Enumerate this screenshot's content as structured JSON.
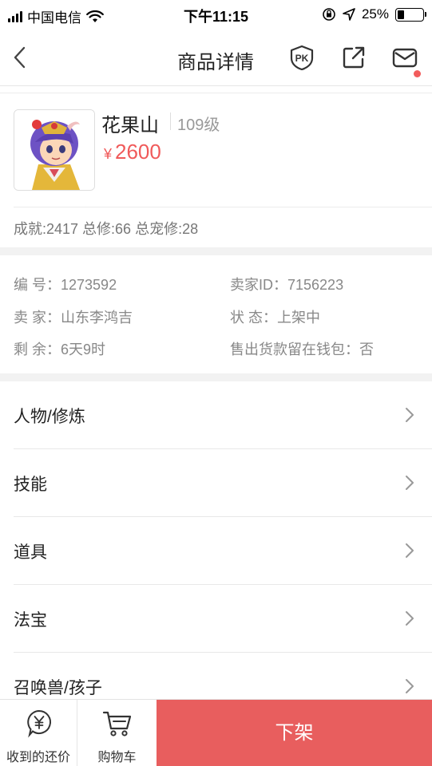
{
  "status_bar": {
    "carrier": "中国电信",
    "time": "下午11:15",
    "battery": "25%",
    "battery_level": 0.25
  },
  "nav": {
    "title": "商品详情",
    "icons": [
      "back-chevron-icon",
      "pk-badge-icon",
      "share-icon",
      "mail-icon"
    ],
    "has_unread_mail": true
  },
  "product": {
    "name": "花果山",
    "level": "109级",
    "currency_symbol": "¥",
    "price": "2600",
    "stats": "成就:2417 总修:66 总宠修:28"
  },
  "info": {
    "serial_number": "编 号：1273592",
    "seller_id": "卖家ID：7156223",
    "seller": "卖 家：山东李鸿吉",
    "status": "状 态：上架中",
    "remaining": "剩 余：6天9时",
    "proceeds_in_wallet": "售出货款留在钱包：否"
  },
  "menu": [
    {
      "label": "人物/修炼"
    },
    {
      "label": "技能"
    },
    {
      "label": "道具"
    },
    {
      "label": "法宝"
    },
    {
      "label": "召唤兽/孩子"
    }
  ],
  "bottom_bar": {
    "offers_label": "收到的还价",
    "cart_label": "购物车",
    "delist_label": "下架"
  },
  "colors": {
    "price": "#f05a5a",
    "delist_button": "#e85e5e",
    "notification_dot": "#f25c5c"
  }
}
